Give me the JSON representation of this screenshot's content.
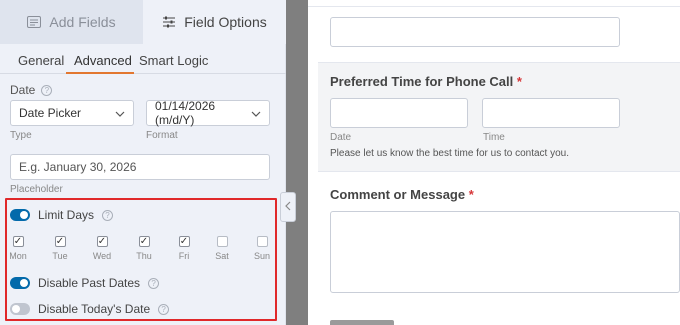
{
  "top_tabs": [
    {
      "label": "Add Fields",
      "icon": "table-icon",
      "active": false
    },
    {
      "label": "Field Options",
      "icon": "sliders-icon",
      "active": true
    }
  ],
  "sub_tabs": [
    {
      "label": "General",
      "active": false
    },
    {
      "label": "Advanced",
      "active": true
    },
    {
      "label": "Smart Logic",
      "active": false
    }
  ],
  "date_section": {
    "label": "Date",
    "type_value": "Date Picker",
    "type_label": "Type",
    "format_value": "01/14/2026 (m/d/Y)",
    "format_label": "Format",
    "placeholder_value": "E.g. January 30, 2026",
    "placeholder_label": "Placeholder"
  },
  "limit_days": {
    "label": "Limit Days",
    "enabled": true,
    "days": [
      {
        "label": "Mon",
        "checked": true
      },
      {
        "label": "Tue",
        "checked": true
      },
      {
        "label": "Wed",
        "checked": true
      },
      {
        "label": "Thu",
        "checked": true
      },
      {
        "label": "Fri",
        "checked": true
      },
      {
        "label": "Sat",
        "checked": false
      },
      {
        "label": "Sun",
        "checked": false
      }
    ]
  },
  "disable_past_dates": {
    "label": "Disable Past Dates",
    "enabled": true
  },
  "disable_today": {
    "label": "Disable Today's Date",
    "enabled": false
  },
  "preview": {
    "phone_call_title": "Preferred Time for Phone Call",
    "required_mark": "*",
    "date_sublabel": "Date",
    "time_sublabel": "Time",
    "description": "Please let us know the best time for us to contact you.",
    "comment_title": "Comment or Message"
  },
  "colors": {
    "accent": "#e27730",
    "toggle_on": "#036aab",
    "highlight_border": "#e0282a",
    "required": "#d63638"
  }
}
